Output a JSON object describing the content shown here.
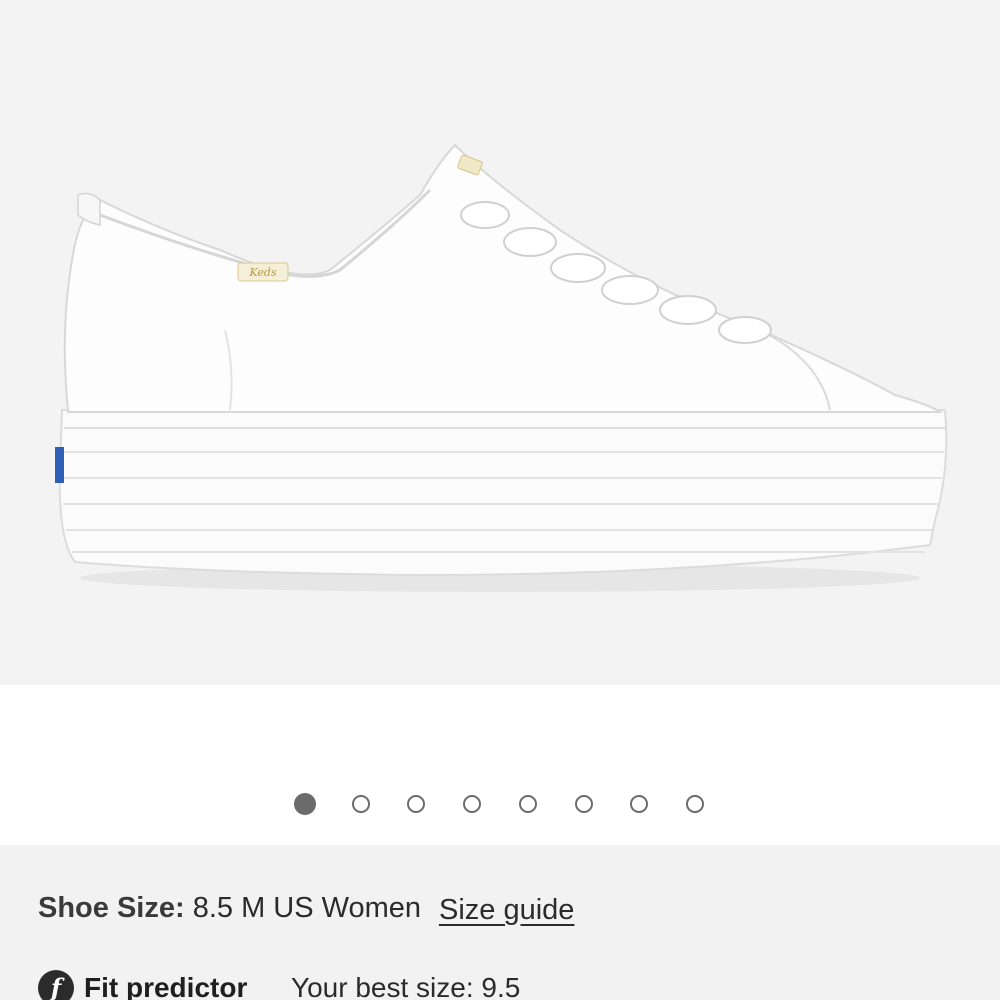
{
  "carousel": {
    "slide_count": 8,
    "active_index": 0,
    "image": {
      "label": "Keds"
    }
  },
  "details": {
    "shoe_size_label": "Shoe Size:",
    "shoe_size_value": "8.5 M US Women",
    "size_guide_link": "Size guide",
    "fit_icon_glyph": "f",
    "fit_predictor_label": "Fit predictor",
    "best_size_text": "Your best size: 9.5"
  },
  "colors": {
    "hero_background": "#f3f3f3",
    "info_background": "#f2f2f2",
    "dot_color": "#6b6b6b",
    "text_dark": "#2b2b2b"
  }
}
